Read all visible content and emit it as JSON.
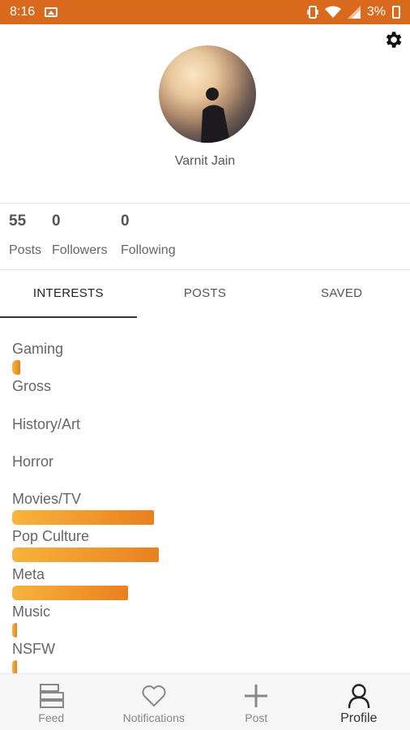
{
  "status_bar": {
    "time": "8:16",
    "battery": "3%"
  },
  "profile": {
    "name": "Varnit Jain"
  },
  "stats": [
    {
      "value": "55",
      "label": "Posts"
    },
    {
      "value": "0",
      "label": "Followers"
    },
    {
      "value": "0",
      "label": "Following"
    }
  ],
  "tabs": [
    {
      "label": "INTERESTS",
      "active": true
    },
    {
      "label": "POSTS",
      "active": false
    },
    {
      "label": "SAVED",
      "active": false
    }
  ],
  "interests": [
    {
      "name": "Gaming",
      "level": 0.05
    },
    {
      "name": "Gross",
      "level": 0
    },
    {
      "name": "History/Art",
      "level": 0
    },
    {
      "name": "Horror",
      "level": 0
    },
    {
      "name": "Movies/TV",
      "level": 0.92
    },
    {
      "name": "Pop Culture",
      "level": 0.95
    },
    {
      "name": "Meta",
      "level": 0.75
    },
    {
      "name": "Music",
      "level": 0.03
    },
    {
      "name": "NSFW",
      "level": 0.03
    }
  ],
  "bottom_nav": [
    {
      "label": "Feed",
      "icon": "feed-icon",
      "active": false
    },
    {
      "label": "Notifications",
      "icon": "heart-icon",
      "active": false
    },
    {
      "label": "Post",
      "icon": "plus-icon",
      "active": false
    },
    {
      "label": "Profile",
      "icon": "person-icon",
      "active": true
    }
  ],
  "colors": {
    "status_bar": "#d9691c",
    "bar_start": "#f7b43d",
    "bar_end": "#e9801f"
  }
}
